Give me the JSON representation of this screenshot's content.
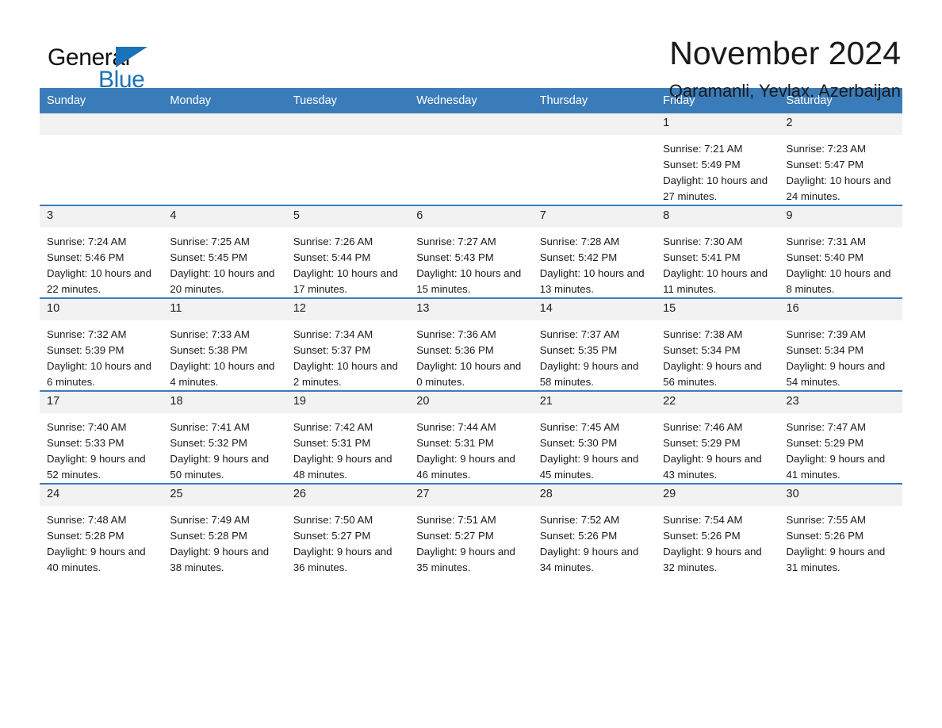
{
  "logo": {
    "word_one": "General",
    "word_two": "Blue",
    "triangle_color": "#1b72b8"
  },
  "header": {
    "title": "November 2024",
    "location": "Qaramanli, Yevlax, Azerbaijan"
  },
  "theme": {
    "header_row_bg": "#3a7cba",
    "daynum_bg": "#f2f2f2",
    "rule_color": "#3a7cba",
    "text_color": "#1a1a1a"
  },
  "calendar": {
    "weekday_headers": [
      "Sunday",
      "Monday",
      "Tuesday",
      "Wednesday",
      "Thursday",
      "Friday",
      "Saturday"
    ],
    "weeks": [
      [
        {
          "day": "",
          "sunrise": "",
          "sunset": "",
          "daylight": ""
        },
        {
          "day": "",
          "sunrise": "",
          "sunset": "",
          "daylight": ""
        },
        {
          "day": "",
          "sunrise": "",
          "sunset": "",
          "daylight": ""
        },
        {
          "day": "",
          "sunrise": "",
          "sunset": "",
          "daylight": ""
        },
        {
          "day": "",
          "sunrise": "",
          "sunset": "",
          "daylight": ""
        },
        {
          "day": "1",
          "sunrise": "Sunrise: 7:21 AM",
          "sunset": "Sunset: 5:49 PM",
          "daylight": "Daylight: 10 hours and 27 minutes."
        },
        {
          "day": "2",
          "sunrise": "Sunrise: 7:23 AM",
          "sunset": "Sunset: 5:47 PM",
          "daylight": "Daylight: 10 hours and 24 minutes."
        }
      ],
      [
        {
          "day": "3",
          "sunrise": "Sunrise: 7:24 AM",
          "sunset": "Sunset: 5:46 PM",
          "daylight": "Daylight: 10 hours and 22 minutes."
        },
        {
          "day": "4",
          "sunrise": "Sunrise: 7:25 AM",
          "sunset": "Sunset: 5:45 PM",
          "daylight": "Daylight: 10 hours and 20 minutes."
        },
        {
          "day": "5",
          "sunrise": "Sunrise: 7:26 AM",
          "sunset": "Sunset: 5:44 PM",
          "daylight": "Daylight: 10 hours and 17 minutes."
        },
        {
          "day": "6",
          "sunrise": "Sunrise: 7:27 AM",
          "sunset": "Sunset: 5:43 PM",
          "daylight": "Daylight: 10 hours and 15 minutes."
        },
        {
          "day": "7",
          "sunrise": "Sunrise: 7:28 AM",
          "sunset": "Sunset: 5:42 PM",
          "daylight": "Daylight: 10 hours and 13 minutes."
        },
        {
          "day": "8",
          "sunrise": "Sunrise: 7:30 AM",
          "sunset": "Sunset: 5:41 PM",
          "daylight": "Daylight: 10 hours and 11 minutes."
        },
        {
          "day": "9",
          "sunrise": "Sunrise: 7:31 AM",
          "sunset": "Sunset: 5:40 PM",
          "daylight": "Daylight: 10 hours and 8 minutes."
        }
      ],
      [
        {
          "day": "10",
          "sunrise": "Sunrise: 7:32 AM",
          "sunset": "Sunset: 5:39 PM",
          "daylight": "Daylight: 10 hours and 6 minutes."
        },
        {
          "day": "11",
          "sunrise": "Sunrise: 7:33 AM",
          "sunset": "Sunset: 5:38 PM",
          "daylight": "Daylight: 10 hours and 4 minutes."
        },
        {
          "day": "12",
          "sunrise": "Sunrise: 7:34 AM",
          "sunset": "Sunset: 5:37 PM",
          "daylight": "Daylight: 10 hours and 2 minutes."
        },
        {
          "day": "13",
          "sunrise": "Sunrise: 7:36 AM",
          "sunset": "Sunset: 5:36 PM",
          "daylight": "Daylight: 10 hours and 0 minutes."
        },
        {
          "day": "14",
          "sunrise": "Sunrise: 7:37 AM",
          "sunset": "Sunset: 5:35 PM",
          "daylight": "Daylight: 9 hours and 58 minutes."
        },
        {
          "day": "15",
          "sunrise": "Sunrise: 7:38 AM",
          "sunset": "Sunset: 5:34 PM",
          "daylight": "Daylight: 9 hours and 56 minutes."
        },
        {
          "day": "16",
          "sunrise": "Sunrise: 7:39 AM",
          "sunset": "Sunset: 5:34 PM",
          "daylight": "Daylight: 9 hours and 54 minutes."
        }
      ],
      [
        {
          "day": "17",
          "sunrise": "Sunrise: 7:40 AM",
          "sunset": "Sunset: 5:33 PM",
          "daylight": "Daylight: 9 hours and 52 minutes."
        },
        {
          "day": "18",
          "sunrise": "Sunrise: 7:41 AM",
          "sunset": "Sunset: 5:32 PM",
          "daylight": "Daylight: 9 hours and 50 minutes."
        },
        {
          "day": "19",
          "sunrise": "Sunrise: 7:42 AM",
          "sunset": "Sunset: 5:31 PM",
          "daylight": "Daylight: 9 hours and 48 minutes."
        },
        {
          "day": "20",
          "sunrise": "Sunrise: 7:44 AM",
          "sunset": "Sunset: 5:31 PM",
          "daylight": "Daylight: 9 hours and 46 minutes."
        },
        {
          "day": "21",
          "sunrise": "Sunrise: 7:45 AM",
          "sunset": "Sunset: 5:30 PM",
          "daylight": "Daylight: 9 hours and 45 minutes."
        },
        {
          "day": "22",
          "sunrise": "Sunrise: 7:46 AM",
          "sunset": "Sunset: 5:29 PM",
          "daylight": "Daylight: 9 hours and 43 minutes."
        },
        {
          "day": "23",
          "sunrise": "Sunrise: 7:47 AM",
          "sunset": "Sunset: 5:29 PM",
          "daylight": "Daylight: 9 hours and 41 minutes."
        }
      ],
      [
        {
          "day": "24",
          "sunrise": "Sunrise: 7:48 AM",
          "sunset": "Sunset: 5:28 PM",
          "daylight": "Daylight: 9 hours and 40 minutes."
        },
        {
          "day": "25",
          "sunrise": "Sunrise: 7:49 AM",
          "sunset": "Sunset: 5:28 PM",
          "daylight": "Daylight: 9 hours and 38 minutes."
        },
        {
          "day": "26",
          "sunrise": "Sunrise: 7:50 AM",
          "sunset": "Sunset: 5:27 PM",
          "daylight": "Daylight: 9 hours and 36 minutes."
        },
        {
          "day": "27",
          "sunrise": "Sunrise: 7:51 AM",
          "sunset": "Sunset: 5:27 PM",
          "daylight": "Daylight: 9 hours and 35 minutes."
        },
        {
          "day": "28",
          "sunrise": "Sunrise: 7:52 AM",
          "sunset": "Sunset: 5:26 PM",
          "daylight": "Daylight: 9 hours and 34 minutes."
        },
        {
          "day": "29",
          "sunrise": "Sunrise: 7:54 AM",
          "sunset": "Sunset: 5:26 PM",
          "daylight": "Daylight: 9 hours and 32 minutes."
        },
        {
          "day": "30",
          "sunrise": "Sunrise: 7:55 AM",
          "sunset": "Sunset: 5:26 PM",
          "daylight": "Daylight: 9 hours and 31 minutes."
        }
      ]
    ]
  }
}
